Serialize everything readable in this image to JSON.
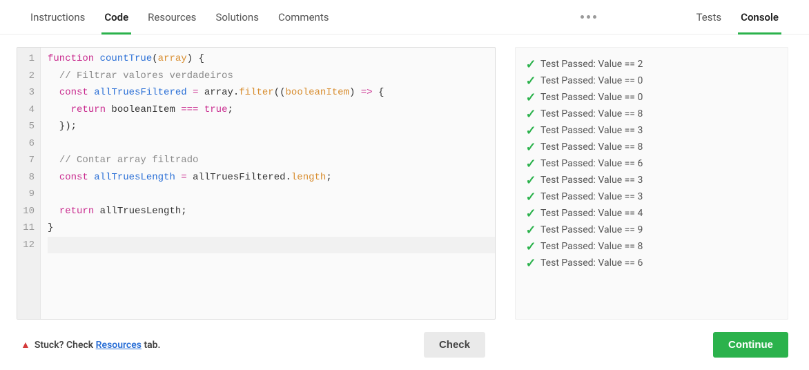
{
  "tabs_left": [
    {
      "label": "Instructions",
      "active": false
    },
    {
      "label": "Code",
      "active": true
    },
    {
      "label": "Resources",
      "active": false
    },
    {
      "label": "Solutions",
      "active": false
    },
    {
      "label": "Comments",
      "active": false
    }
  ],
  "tabs_right": [
    {
      "label": "Tests",
      "active": false
    },
    {
      "label": "Console",
      "active": true
    }
  ],
  "editor": {
    "line_count": 12,
    "current_line_index": 11,
    "code_tokens": [
      [
        [
          "kw",
          "function "
        ],
        [
          "fn",
          "countTrue"
        ],
        [
          "plain",
          "("
        ],
        [
          "param",
          "array"
        ],
        [
          "plain",
          ") {"
        ]
      ],
      [
        [
          "plain",
          "  "
        ],
        [
          "comment",
          "// Filtrar valores verdadeiros"
        ]
      ],
      [
        [
          "plain",
          "  "
        ],
        [
          "kw",
          "const "
        ],
        [
          "var",
          "allTruesFiltered"
        ],
        [
          "plain",
          " "
        ],
        [
          "op",
          "="
        ],
        [
          "plain",
          " array."
        ],
        [
          "prop",
          "filter"
        ],
        [
          "plain",
          "(("
        ],
        [
          "param",
          "booleanItem"
        ],
        [
          "plain",
          ") "
        ],
        [
          "op",
          "=>"
        ],
        [
          "plain",
          " {"
        ]
      ],
      [
        [
          "plain",
          "    "
        ],
        [
          "kw",
          "return"
        ],
        [
          "plain",
          " booleanItem "
        ],
        [
          "op",
          "==="
        ],
        [
          "plain",
          " "
        ],
        [
          "bool",
          "true"
        ],
        [
          "plain",
          ";"
        ]
      ],
      [
        [
          "plain",
          "  });"
        ]
      ],
      [],
      [
        [
          "plain",
          "  "
        ],
        [
          "comment",
          "// Contar array filtrado"
        ]
      ],
      [
        [
          "plain",
          "  "
        ],
        [
          "kw",
          "const "
        ],
        [
          "var",
          "allTruesLength"
        ],
        [
          "plain",
          " "
        ],
        [
          "op",
          "="
        ],
        [
          "plain",
          " allTruesFiltered."
        ],
        [
          "prop",
          "length"
        ],
        [
          "plain",
          ";"
        ]
      ],
      [],
      [
        [
          "plain",
          "  "
        ],
        [
          "kw",
          "return"
        ],
        [
          "plain",
          " allTruesLength;"
        ]
      ],
      [
        [
          "plain",
          "}"
        ]
      ],
      []
    ]
  },
  "console": {
    "test_prefix": "Test Passed: Value == ",
    "results": [
      "2",
      "0",
      "0",
      "8",
      "3",
      "8",
      "6",
      "3",
      "3",
      "4",
      "9",
      "8",
      "6"
    ]
  },
  "footer": {
    "stuck_prefix": "Stuck? Check ",
    "stuck_link": "Resources",
    "stuck_suffix": " tab.",
    "check_label": "Check",
    "continue_label": "Continue"
  }
}
